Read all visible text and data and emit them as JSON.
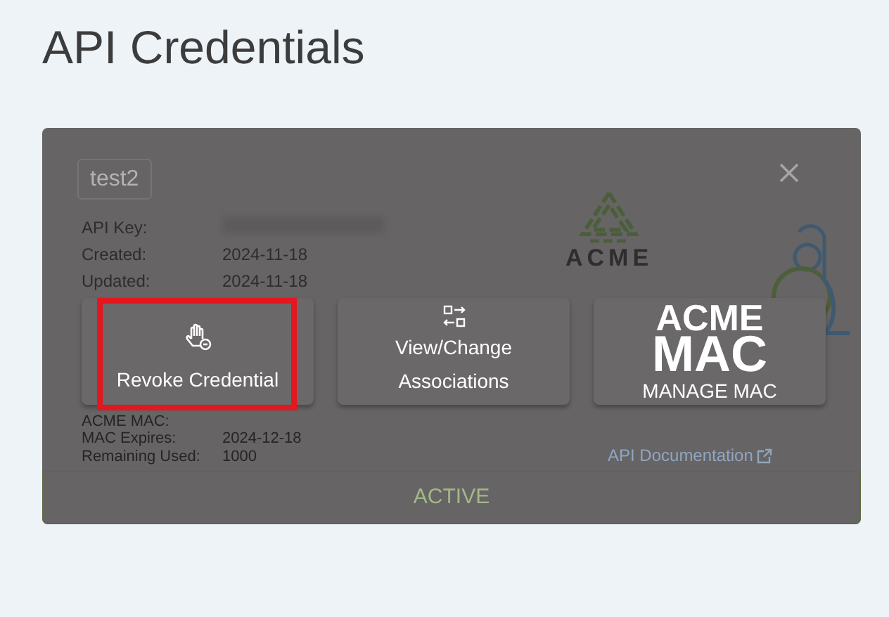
{
  "page": {
    "title": "API Credentials"
  },
  "credential": {
    "name": "test2",
    "fields": [
      {
        "kind": "redacted",
        "label": "API Key:"
      },
      {
        "kind": "text",
        "label": "Created:",
        "value": "2024-11-18"
      },
      {
        "kind": "text",
        "label": "Updated:",
        "value": "2024-11-18"
      }
    ],
    "logo_text": "ACME",
    "mac": [
      {
        "label": "ACME MAC:"
      },
      {
        "label": "MAC Expires:",
        "value": "2024-12-18"
      },
      {
        "label": "Remaining Used:",
        "value": "1000"
      }
    ],
    "doc_link": "API Documentation",
    "status": "ACTIVE"
  },
  "actions": [
    {
      "kind": "icon",
      "label": "Revoke Credential",
      "highlighted": true
    },
    {
      "kind": "icon",
      "label": "View/Change Associations",
      "highlighted": false
    },
    {
      "kind": "logo",
      "logo": [
        "ACME",
        "MAC"
      ],
      "label": "MANAGE MAC",
      "highlighted": false
    }
  ]
}
